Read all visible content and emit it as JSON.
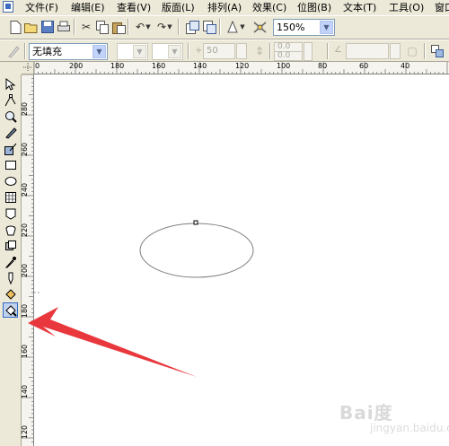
{
  "menu": {
    "items": [
      "文件(F)",
      "编辑(E)",
      "查看(V)",
      "版面(L)",
      "排列(A)",
      "效果(C)",
      "位图(B)",
      "文本(T)",
      "工具(O)",
      "窗口"
    ]
  },
  "toolbar": {
    "zoom_value": "150%"
  },
  "property_bar": {
    "fill_value": "无填充",
    "outline_width": "50",
    "offset_x": "0.0",
    "offset_y": "0.0"
  },
  "hruler": {
    "labels": [
      "200",
      "180",
      "160",
      "140",
      "120",
      "100",
      "80",
      "60",
      "40"
    ],
    "start": "0"
  },
  "vruler": {
    "labels": [
      "280",
      "260",
      "240",
      "220",
      "200",
      "180",
      "160",
      "140",
      "120"
    ]
  },
  "watermark": {
    "text": "Bai度",
    "sub": "jingyan.baidu.com"
  },
  "colors": {
    "arrow": "#e8383d",
    "ellipse_stroke": "#808080",
    "ui_face": "#ece9d8"
  }
}
